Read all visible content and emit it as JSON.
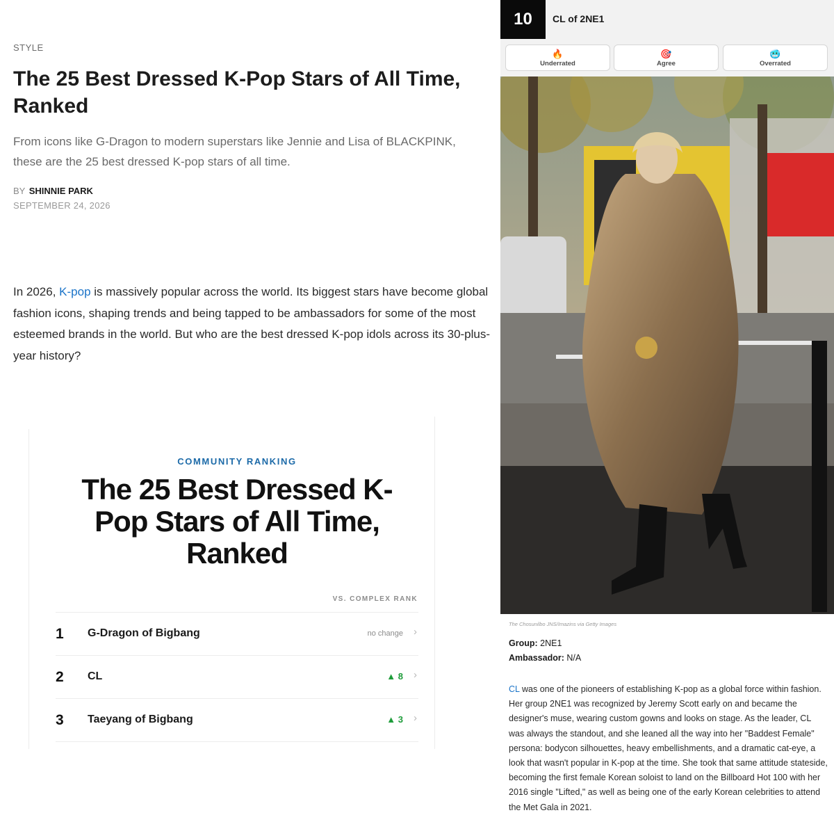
{
  "article": {
    "kicker": "STYLE",
    "headline": "The 25 Best Dressed K-Pop Stars of All Time, Ranked",
    "dek": "From icons like G-Dragon to modern superstars like Jennie and Lisa of BLACKPINK, these are the 25 best dressed K-pop stars of all time.",
    "byline_prefix": "BY",
    "author": "SHINNIE PARK",
    "date": "SEPTEMBER 24, 2026",
    "body_before_link": "In 2026, ",
    "body_link": "K-pop",
    "body_after_link": " is massively popular across the world. Its biggest stars have become global fashion icons, shaping trends and being tapped to be ambassadors for some of the most esteemed brands in the world. But who are the best dressed K-pop idols across its 30-plus-year history?"
  },
  "ranking": {
    "label": "COMMUNITY RANKING",
    "title": "The 25 Best Dressed K-Pop Stars of All Time, Ranked",
    "vs_label": "VS. COMPLEX RANK",
    "rows": [
      {
        "rank": "1",
        "name": "G-Dragon of Bigbang",
        "change": "no change",
        "direction": "none"
      },
      {
        "rank": "2",
        "name": "CL",
        "change": "▲ 8",
        "direction": "up"
      },
      {
        "rank": "3",
        "name": "Taeyang of Bigbang",
        "change": "▲ 3",
        "direction": "up"
      }
    ]
  },
  "entry": {
    "rank": "10",
    "name": "CL of 2NE1",
    "votes": [
      {
        "label": "Underrated",
        "icon": "fire-icon",
        "glyph": "🔥"
      },
      {
        "label": "Agree",
        "icon": "target-icon",
        "glyph": "🎯"
      },
      {
        "label": "Overrated",
        "icon": "cold-face-icon",
        "glyph": "🥶"
      }
    ],
    "caption": "The Chosunilbo JNS/Imazins via Getty Images",
    "group_label": "Group:",
    "group_value": " 2NE1",
    "ambassador_label": "Ambassador:",
    "ambassador_value": " N/A",
    "body_link": "CL",
    "body_text": " was one of the pioneers of establishing K-pop as a global force within fashion. Her group 2NE1 was recognized by Jeremy Scott early on and became the designer's muse, wearing custom gowns and looks on stage. As the leader, CL was always the standout, and she leaned all the way into her \"Baddest Female\" persona: bodycon silhouettes, heavy embellishments, and a dramatic cat-eye, a look that wasn't popular in K-pop at the time. She took that same attitude stateside, becoming the first female Korean soloist to land on the Billboard Hot 100 with her 2016 single \"Lifted,\" as well as being one of the early Korean celebrities to attend the Met Gala in 2021."
  },
  "colors": {
    "link": "#1a73c8",
    "ranking_label": "#1c6aa8",
    "rank_up": "#1e9c3a",
    "rank_badge": "#0a0a0a"
  }
}
